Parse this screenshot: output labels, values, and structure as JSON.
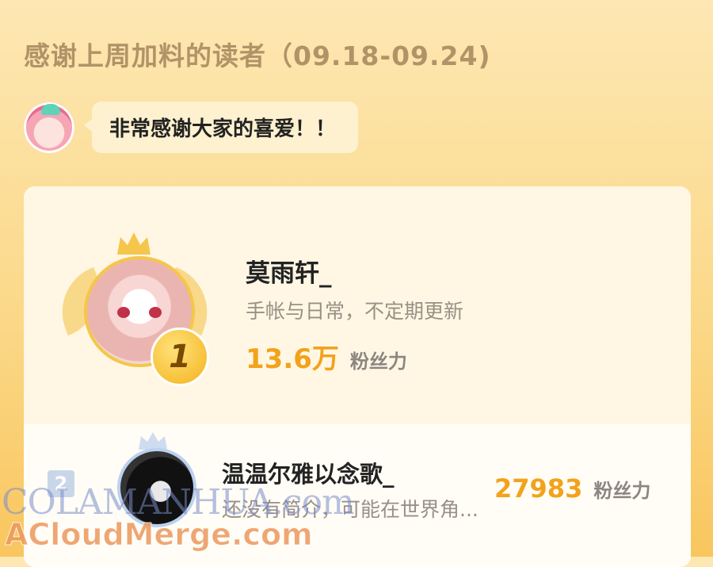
{
  "header": {
    "title": "感谢上周加料的读者（09.18-09.24)"
  },
  "author_message": {
    "text": "非常感谢大家的喜爱！！"
  },
  "ranking": [
    {
      "rank": "1",
      "name": "莫雨轩_",
      "desc": "手帐与日常，不定期更新",
      "count": "13.6万",
      "fans_label": "粉丝力"
    },
    {
      "rank": "2",
      "name": "温温尔雅以念歌_",
      "desc": "还没有简介，可能在世界角...",
      "count": "27983",
      "fans_label": "粉丝力"
    }
  ],
  "watermarks": {
    "line1": "COLAMANHUA.com",
    "line2": "ACloudMerge.com"
  },
  "colors": {
    "accent": "#f3a21b",
    "crown_gold": "#f5c64b",
    "rank2_blue": "#c9d6ea"
  }
}
